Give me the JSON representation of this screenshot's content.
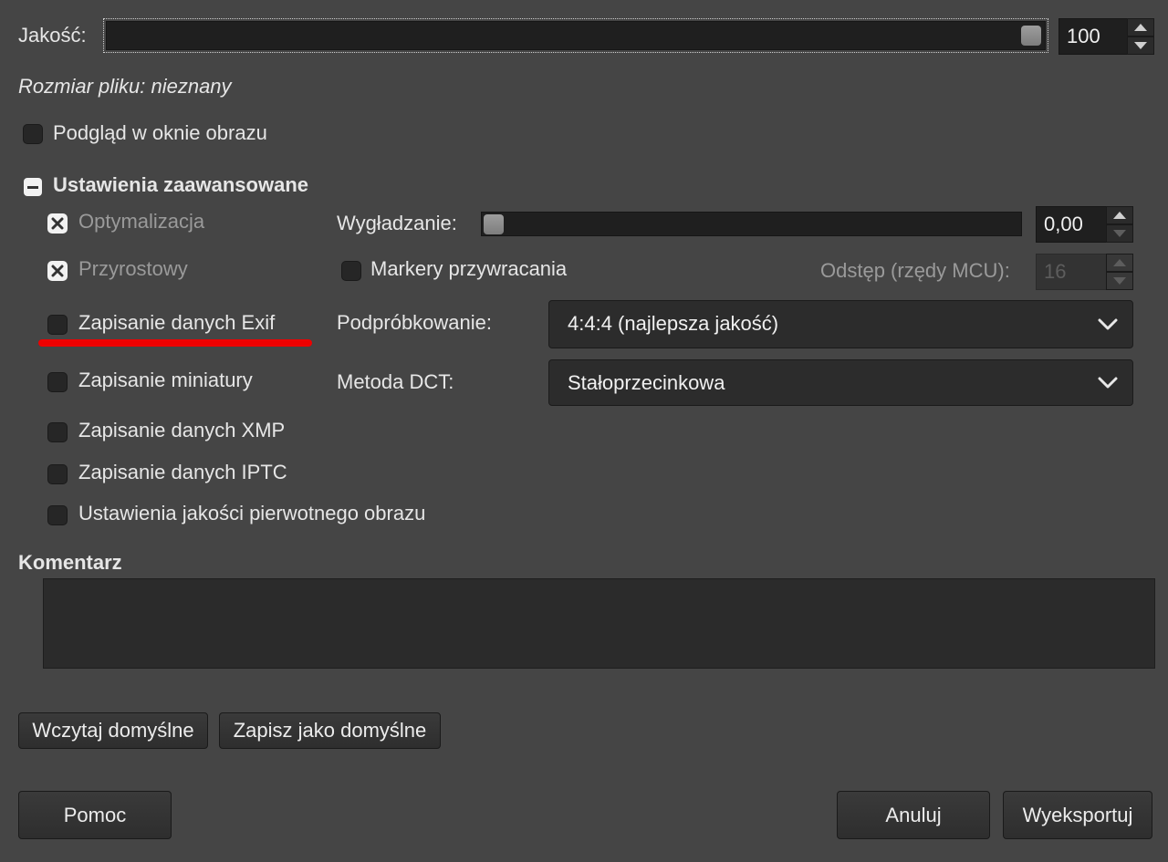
{
  "quality": {
    "label": "Jakość:",
    "value": "100",
    "level_fraction": 1.0
  },
  "file_size": {
    "text": "Rozmiar pliku: nieznany"
  },
  "preview": {
    "label": "Podgląd w oknie obrazu",
    "checked": false
  },
  "advanced": {
    "title": "Ustawienia zaawansowane",
    "options": [
      {
        "label": "Optymalizacja",
        "checked": true
      },
      {
        "label": "Przyrostowy",
        "checked": true
      },
      {
        "label": "Zapisanie danych Exif",
        "checked": false
      },
      {
        "label": "Zapisanie miniatury",
        "checked": false
      },
      {
        "label": "Zapisanie danych XMP",
        "checked": false
      },
      {
        "label": "Zapisanie danych IPTC",
        "checked": false
      },
      {
        "label": "Ustawienia jakości pierwotnego obrazu",
        "checked": false
      }
    ],
    "smoothing": {
      "label": "Wygładzanie:",
      "value": "0,00",
      "level_fraction": 0.0
    },
    "restart_markers": {
      "label": "Markery przywracania",
      "checked": false
    },
    "interval": {
      "label": "Odstęp (rzędy MCU):",
      "value": "16"
    },
    "subsampling": {
      "label": "Podpróbkowanie:",
      "selected": "4:4:4 (najlepsza jakość)"
    },
    "dct": {
      "label": "Metoda DCT:",
      "selected": "Stałoprzecinkowa"
    }
  },
  "comment": {
    "label": "Komentarz",
    "value": ""
  },
  "buttons": {
    "load_defaults": "Wczytaj domyślne",
    "save_defaults": "Zapisz jako domyślne",
    "help": "Pomoc",
    "cancel": "Anuluj",
    "export": "Wyeksportuj"
  },
  "colors": {
    "background": "#454545",
    "annotation_underline": "#e00000"
  },
  "icons": {
    "checkbox_mark": "cross-icon",
    "expander": "minus-icon",
    "dropdown": "chevron-down-icon",
    "spin": "arrow-up-down-icon"
  }
}
